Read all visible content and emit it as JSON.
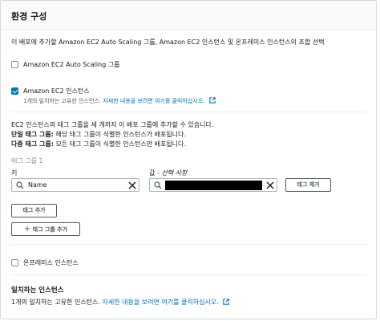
{
  "section": {
    "title": "환경 구성",
    "description": "이 배포에 추가할 Amazon EC2 Auto Scaling 그룹, Amazon EC2 인스턴스 및 온프레미스 인스턴스의 조합 선택"
  },
  "options": {
    "asg": {
      "label": "Amazon EC2 Auto Scaling 그룹",
      "checked": false
    },
    "ec2": {
      "label": "Amazon EC2 인스턴스",
      "checked": true,
      "sub_text": "1개의 일치하는 고유한 인스턴스.",
      "sub_link": "자세한 내용을 보려면 여기를 클릭하십시오."
    },
    "onprem": {
      "label": "온프레미스 인스턴스",
      "checked": false
    }
  },
  "tag_info": {
    "line1": "EC2 인스턴스의 태그 그룹을 세 개까지 이 배포 그룹에 추가할 수 있습니다.",
    "single_bold": "단일 태그 그룹:",
    "single_text": " 해당 태그 그룹이 식별한 인스턴스가 배포됩니다.",
    "multi_bold": "다중 태그 그룹:",
    "multi_text": " 모든 태그 그룹이 식별한 인스턴스만 배포됩니다."
  },
  "tag_group": {
    "title": "태그 그룹 1",
    "key_label": "키",
    "value_label": "값 - ",
    "value_optional": "선택 사항",
    "key_value": "Name",
    "remove_button": "태그 제거",
    "add_tag_button": "태그 추가",
    "add_group_button": "태그 그룹 추가"
  },
  "matching": {
    "title": "일치하는 인스턴스",
    "text": "1개의 일치하는 고유한 인스턴스.",
    "link": "자세한 내용을 보려면 여기를 클릭하십시오."
  },
  "colors": {
    "accent": "#0073bb",
    "text": "#16191f",
    "muted": "#545b64",
    "border": "#aab7b8"
  },
  "icons": [
    "search-icon",
    "clear-icon",
    "external-link-icon",
    "plus-icon",
    "checkmark-icon"
  ]
}
